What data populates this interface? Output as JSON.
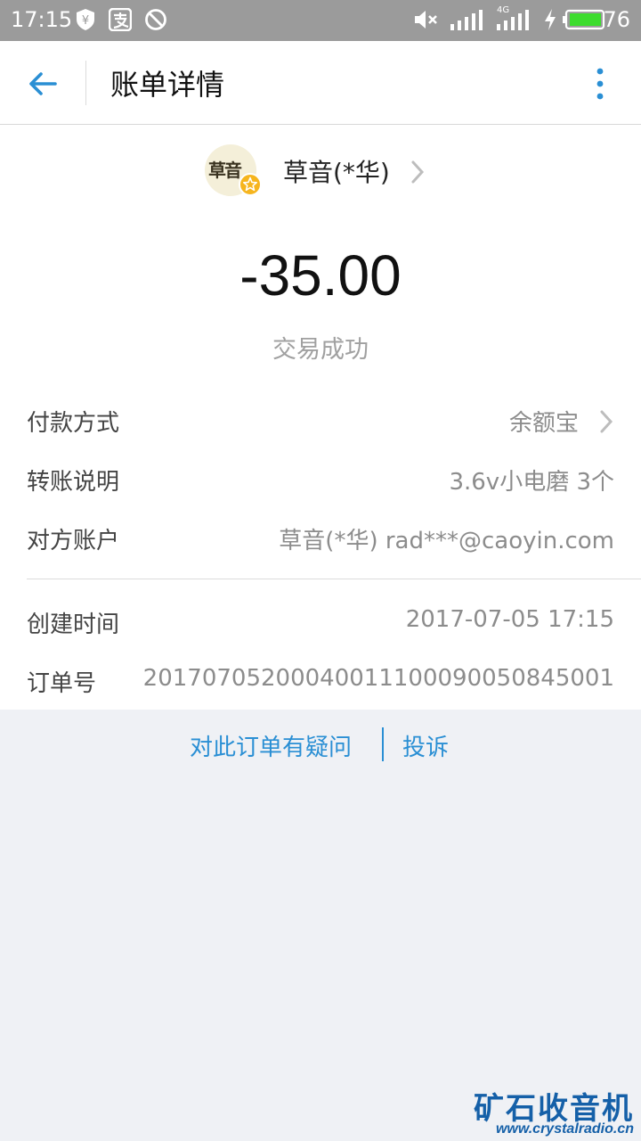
{
  "status_bar": {
    "time": "17:15",
    "signal_label": "4G",
    "battery": "76",
    "icons": [
      "yuan-shield-icon",
      "alipay-icon",
      "no-disturb-icon",
      "mute-icon",
      "signal-icon",
      "signal-4g-icon",
      "charging-icon",
      "battery-icon"
    ]
  },
  "app_bar": {
    "title": "账单详情",
    "back_icon": "back-arrow-icon",
    "more_icon": "more-vertical-icon"
  },
  "merchant": {
    "avatar_text": "草音",
    "name": "草音(*华)"
  },
  "transaction": {
    "amount": "-35.00",
    "status": "交易成功"
  },
  "details": [
    {
      "label": "付款方式",
      "value": "余额宝"
    },
    {
      "label": "转账说明",
      "value": "3.6v小电磨 3个"
    },
    {
      "label": "对方账户",
      "value": "草音(*华) rad***@caoyin.com"
    },
    {
      "label": "创建时间",
      "value": "2017-07-05 17:15"
    },
    {
      "label": "订单号",
      "value": "20170705200040011100090050845001"
    }
  ],
  "links": {
    "question": "对此订单有疑问",
    "complain": "投诉"
  },
  "watermark": {
    "title": "矿石收音机",
    "url": "www.crystalradio.cn"
  },
  "colors": {
    "accent": "#2a8fd4",
    "status_bar": "#9b9b9b",
    "battery": "#3ddc2e",
    "background": "#eff1f5"
  }
}
